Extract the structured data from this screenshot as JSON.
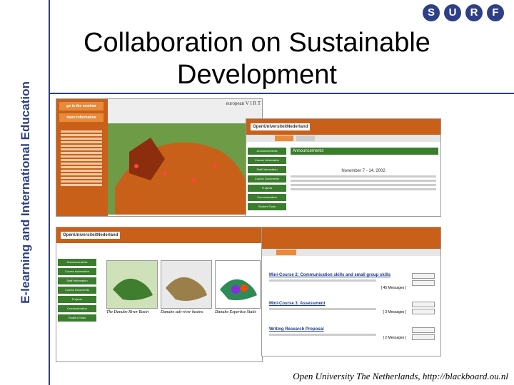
{
  "sidebar": {
    "vertical_title": "E-learning and International Education"
  },
  "header": {
    "title": "Collaboration on Sustainable Development"
  },
  "logo": {
    "letters": [
      "S",
      "U",
      "R",
      "F"
    ],
    "color": "#2d3f87"
  },
  "colors": {
    "accent": "#2d3f87",
    "ou_orange": "#c96019",
    "ou_green": "#3a7d2d"
  },
  "screenshot_1": {
    "tabs": [
      "go to the seminar",
      "more information"
    ],
    "brand": "european V I R T U A L seminar"
  },
  "screenshot_2": {
    "brand": "OpenUniversiteitNederland",
    "section_title": "Announcements",
    "nav": [
      "Announcements",
      "Course Information",
      "Staff Information",
      "Course Documents",
      "Projects",
      "Communication",
      "Student Tools"
    ],
    "date_range": "November 7 - 14, 2002"
  },
  "screenshot_3": {
    "brand": "OpenUniversiteitNederland",
    "nav": [
      "Announcements",
      "Course Information",
      "Staff Information",
      "Course Documents",
      "Projects",
      "Communication",
      "Student Tools"
    ],
    "captions": [
      "The Danube River Basin",
      "Danube sub-river basins",
      "Danube Expertise Statis"
    ]
  },
  "screenshot_4": {
    "rows": [
      {
        "link": "Mini-Course 2: Communication skills and small group skills",
        "count": "[ 45 Messages ]"
      },
      {
        "link": "Mini-Course 3: Assessment",
        "count": "[ 3 Messages ]"
      },
      {
        "link": "Writing Research Proposal",
        "count": "[ 2 Messages ]"
      }
    ]
  },
  "footer": {
    "caption": "Open University The Netherlands, http://blackboard.ou.nl"
  }
}
